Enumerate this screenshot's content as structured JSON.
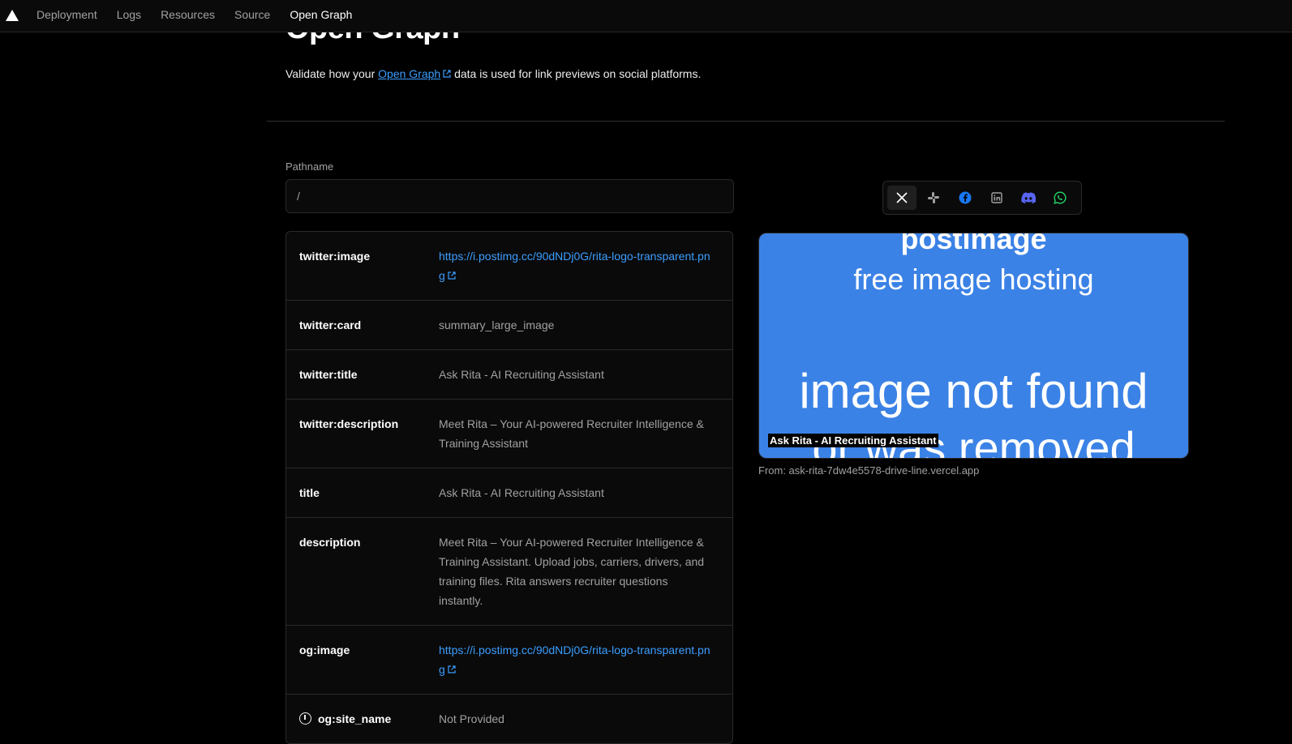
{
  "nav": {
    "items": [
      "Deployment",
      "Logs",
      "Resources",
      "Source",
      "Open Graph"
    ],
    "active": "Open Graph"
  },
  "header": {
    "title": "Open Graph",
    "subtitle_before": "Validate how your",
    "subtitle_link": "Open Graph",
    "subtitle_after": "data is used for link previews on social platforms."
  },
  "pathname": {
    "label": "Pathname",
    "value": "/"
  },
  "meta": [
    {
      "key": "twitter:image",
      "value": "https://i.postimg.cc/90dNDj0G/rita-logo-transparent.png",
      "is_url": true
    },
    {
      "key": "twitter:card",
      "value": "summary_large_image"
    },
    {
      "key": "twitter:title",
      "value": "Ask Rita - AI Recruiting Assistant"
    },
    {
      "key": "twitter:description",
      "value": "Meet Rita – Your AI-powered Recruiter Intelligence & Training Assistant"
    },
    {
      "key": "title",
      "value": "Ask Rita - AI Recruiting Assistant"
    },
    {
      "key": "description",
      "value": "Meet Rita – Your AI-powered Recruiter Intelligence & Training Assistant. Upload jobs, carriers, drivers, and training files. Rita answers recruiter questions instantly."
    },
    {
      "key": "og:image",
      "value": "https://i.postimg.cc/90dNDj0G/rita-logo-transparent.png",
      "is_url": true
    },
    {
      "key": "og:site_name",
      "value": "Not Provided",
      "warning": true
    }
  ],
  "platforms": [
    {
      "name": "x-icon",
      "color": "#ffffff",
      "active": true
    },
    {
      "name": "slack-icon",
      "color": "#a1a1a1"
    },
    {
      "name": "facebook-icon",
      "color": "#1877f2"
    },
    {
      "name": "linkedin-icon",
      "color": "#a1a1a1"
    },
    {
      "name": "discord-icon",
      "color": "#5865f2"
    },
    {
      "name": "whatsapp-icon",
      "color": "#25d366"
    }
  ],
  "preview": {
    "image_line1": "postimage",
    "image_line2": "free image hosting",
    "image_line3": "image not found",
    "image_line4": "or was removed",
    "caption": "Ask Rita - AI Recruiting Assistant",
    "from": "From: ask-rita-7dw4e5578-drive-line.vercel.app"
  }
}
